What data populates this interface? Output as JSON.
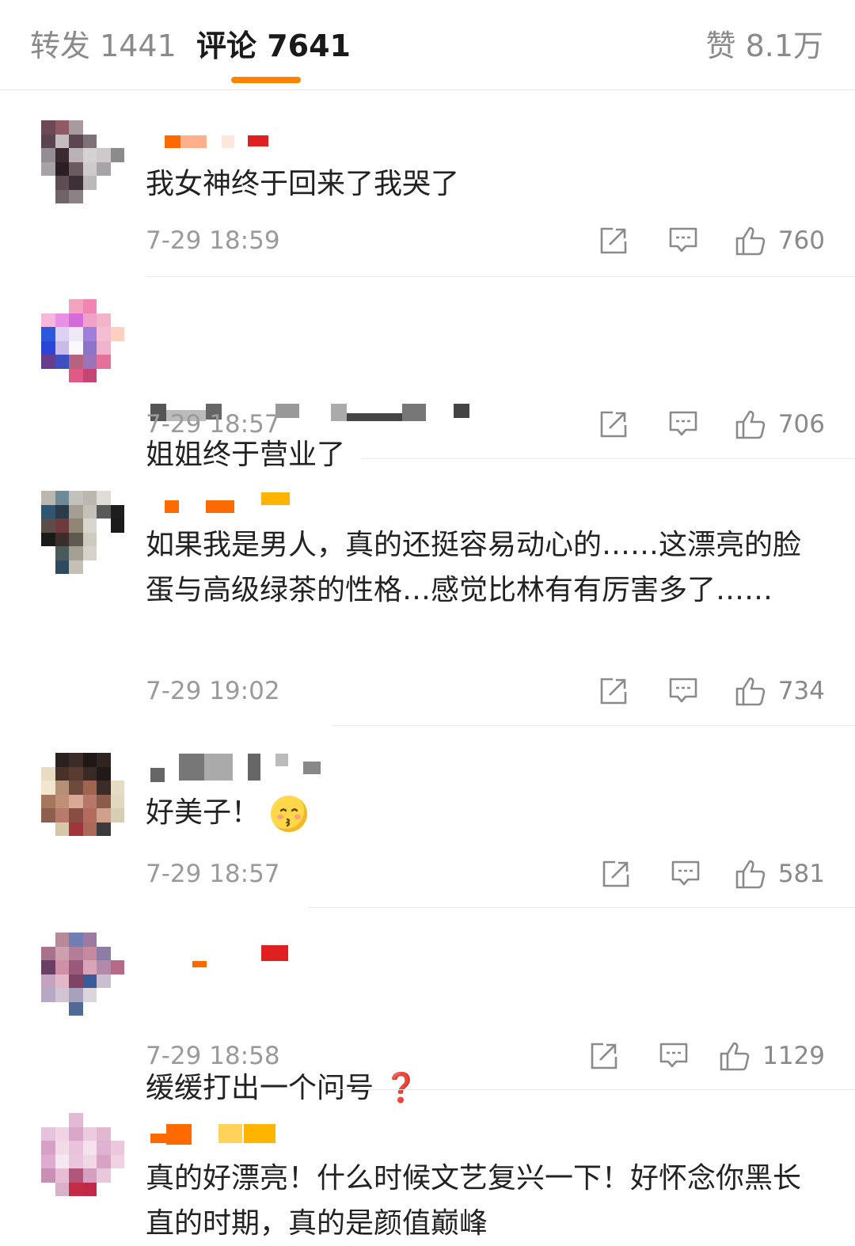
{
  "tabs": {
    "repost": "转发 1441",
    "comment": "评论 7641",
    "like": "赞 8.1万"
  },
  "comments": [
    {
      "text": "我女神终于回来了我哭了",
      "time": "7-29 18:59",
      "likes": "760"
    },
    {
      "text": "姐姐终于营业了",
      "time": "7-29 18:57",
      "likes": "706"
    },
    {
      "text": "如果我是男人，真的还挺容易动心的……这漂亮的脸蛋与高级绿茶的性格…感觉比林有有厉害多了……",
      "time": "7-29 19:02",
      "likes": "734"
    },
    {
      "text": "好美子！",
      "emoji": "kissing-face-emoji",
      "time": "7-29 18:57",
      "likes": "581"
    },
    {
      "text": "缓缓打出一个问号",
      "suffix": "❓",
      "time": "7-29 18:58",
      "likes": "1129"
    },
    {
      "text": "真的好漂亮！什么时候文艺复兴一下！好怀念你黑长直的时期，真的是颜值巅峰",
      "time": "",
      "likes": ""
    }
  ],
  "colors": {
    "accent": "#ff8200",
    "muted": "#9a9a9a",
    "question": "#e0221a"
  },
  "icons": [
    "share-icon",
    "reply-icon",
    "thumbs-up-icon"
  ]
}
